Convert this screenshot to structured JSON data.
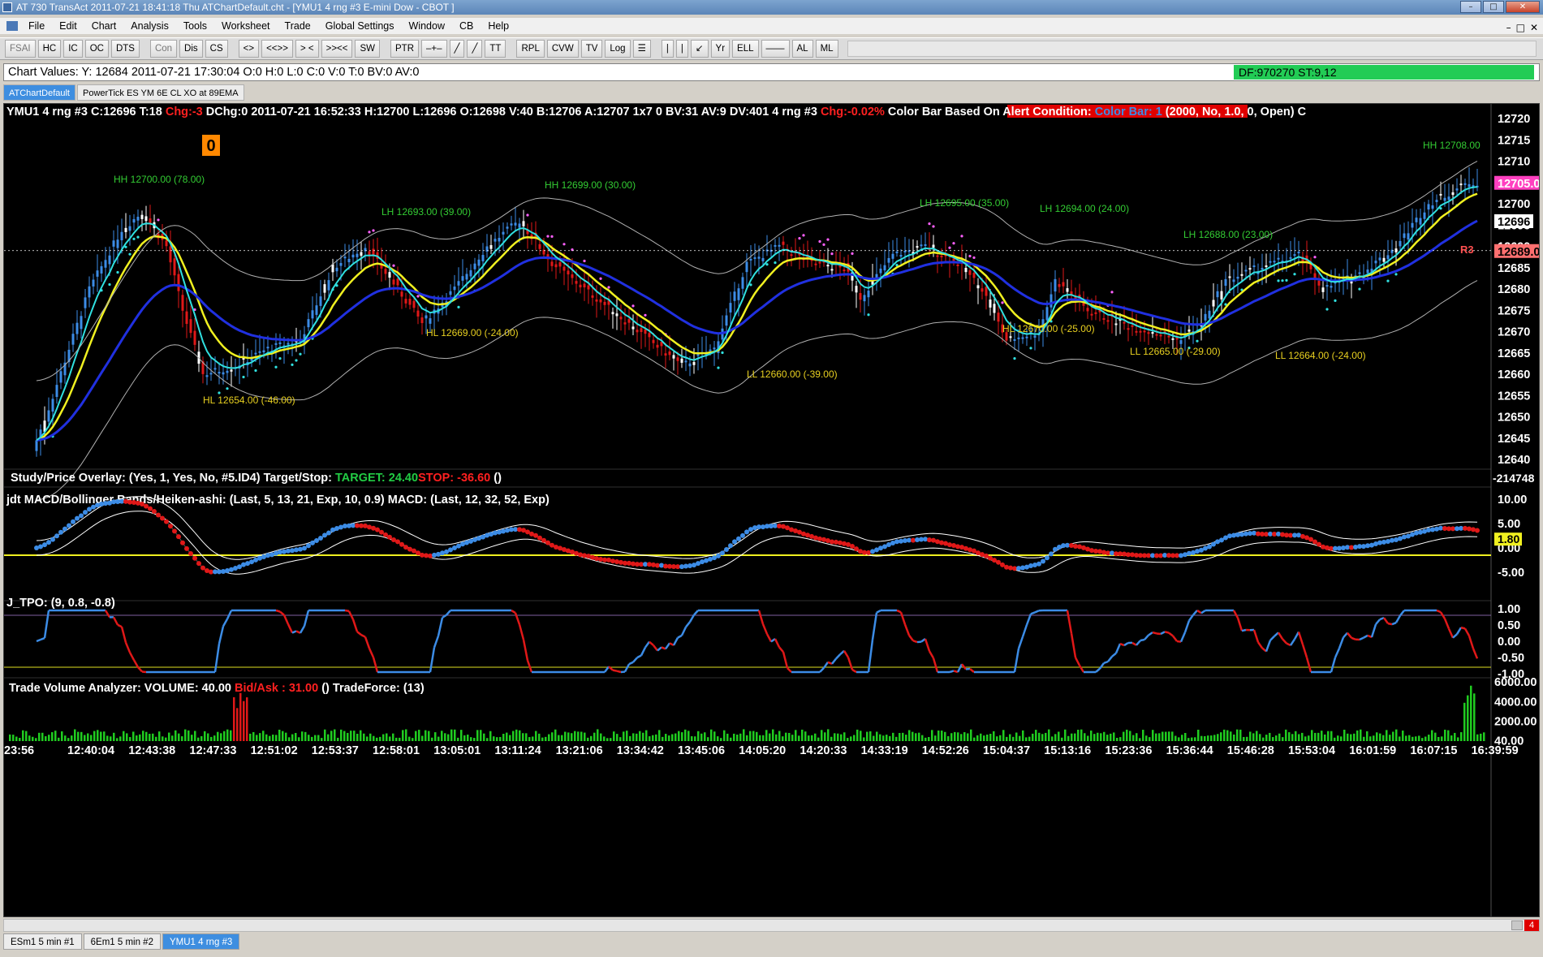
{
  "window": {
    "title": "AT 730 TransAct 2011-07-21  18:41:18  Thu    ATChartDefault.cht - [YMU1  4 rng  #3  E-mini Dow - CBOT    ]",
    "buttons": [
      "–",
      "□",
      "✕"
    ]
  },
  "menu": [
    "File",
    "Edit",
    "Chart",
    "Analysis",
    "Tools",
    "Worksheet",
    "Trade",
    "Global Settings",
    "Window",
    "CB",
    "Help"
  ],
  "mdi_buttons": [
    "–",
    "□",
    "✕"
  ],
  "toolbar": [
    {
      "label": "FSAI",
      "dim": true
    },
    {
      "label": "HC"
    },
    {
      "label": "IC"
    },
    {
      "label": "OC"
    },
    {
      "label": "DTS"
    },
    {
      "label": "Con",
      "dim": true
    },
    {
      "label": "Dis"
    },
    {
      "label": "CS"
    },
    {
      "label": "<>"
    },
    {
      "label": "<<>>"
    },
    {
      "label": "> <"
    },
    {
      "label": ">><<"
    },
    {
      "label": "SW"
    },
    {
      "label": "PTR"
    },
    {
      "label": "–+–"
    },
    {
      "label": "╱"
    },
    {
      "label": "╱"
    },
    {
      "label": "TT"
    },
    {
      "label": "RPL"
    },
    {
      "label": "CVW"
    },
    {
      "label": "TV"
    },
    {
      "label": "Log"
    },
    {
      "label": "☰"
    },
    {
      "label": "|"
    },
    {
      "label": "|"
    },
    {
      "label": "↙"
    },
    {
      "label": "Yr"
    },
    {
      "label": "ELL"
    },
    {
      "label": "——"
    },
    {
      "label": "AL"
    },
    {
      "label": "ML"
    }
  ],
  "values_bar": {
    "text": "Chart Values: Y: 12684  2011-07-21  17:30:04  O:0  H:0  L:0  C:0  V:0  T:0  BV:0  AV:0",
    "df": "DF:970270  ST:9,12"
  },
  "chart_tabs": [
    "ATChartDefault",
    "PowerTick ES YM 6E CL XO at 89EMA"
  ],
  "header": {
    "part1": "YMU1  4 rng  #3 C:12696 T:18 ",
    "chg": "Chg:-3",
    "part2": " DChg:0 2011-07-21 16:52:33 H:12700 L:12696 O:12698 V:40 B:12706 A:12707 1x7 0 BV:31 AV:9 DV:401 4 rng #3 ",
    "chgpct": "Chg:-0.02%",
    "alert": " Color Bar Based On Alert Condition: ",
    "colorbar": "Color Bar: 1",
    "params": "  (2000, No, 1.0, 0, Open)   C"
  },
  "marker": "0",
  "price_axis": [
    "12720",
    "12715",
    "12710",
    "12705",
    "12700",
    "12695",
    "12690",
    "12685",
    "12680",
    "12675",
    "12670",
    "12665",
    "12660",
    "12655",
    "12650",
    "12645",
    "12640"
  ],
  "price_tags": {
    "pink": "12705.0",
    "white": "12696",
    "salmon": "12689.0",
    "r3": "R3"
  },
  "annotations": [
    {
      "text": "HH 12700.00 (78.00)",
      "color": "#33cc33"
    },
    {
      "text": "HL 12654.00 (-46.00)",
      "color": "#e8d020"
    },
    {
      "text": "LH 12693.00 (39.00)",
      "color": "#33cc33"
    },
    {
      "text": "HL 12669.00 (-24.00)",
      "color": "#e8d020"
    },
    {
      "text": "HH 12699.00 (30.00)",
      "color": "#33cc33"
    },
    {
      "text": "LL 12660.00 (-39.00)",
      "color": "#e8d020"
    },
    {
      "text": "LH 12695.00 (35.00)",
      "color": "#33cc33"
    },
    {
      "text": "LH 12694.00 (24.00)",
      "color": "#33cc33"
    },
    {
      "text": "HL 12670.00 (-25.00)",
      "color": "#e8d020"
    },
    {
      "text": "LH 12688.00 (23.00)",
      "color": "#33cc33"
    },
    {
      "text": "LL 12665.00 (-29.00)",
      "color": "#e8d020"
    },
    {
      "text": "LL 12664.00 (-24.00)",
      "color": "#e8d020"
    },
    {
      "text": "HH 12708.00",
      "color": "#33cc33"
    }
  ],
  "overlay_line": {
    "label": "Study/Price Overlay:   (Yes, 1, Yes, No, #5.ID4)   Target/Stop:  ",
    "target": "TARGET: 24.40",
    "stop": "STOP: -36.60",
    "tail": "  ()",
    "axis_value": "-214748"
  },
  "macd_panel": {
    "label": "jdt MACD/Bollinger Bands/Heiken-ashi:   (Last, 5, 13, 21, Exp, 10, 0.9)   MACD:   (Last, 12, 32, 52, Exp)",
    "axis": [
      "10.00",
      "5.00",
      "0.00",
      "-5.00"
    ],
    "value_tag": "1.80"
  },
  "tpo_panel": {
    "label": "J_TPO:   (9, 0.8, -0.8)",
    "axis": [
      "1.00",
      "0.50",
      "0.00",
      "-0.50",
      "-1.00"
    ]
  },
  "volume_panel": {
    "label": "Trade Volume Analyzer:  VOLUME: 40.00  ",
    "bidask": "Bid/Ask : 31.00",
    "tail": "  ()   TradeForce:   (13)",
    "axis": [
      "6000.00",
      "4000.00",
      "2000.00",
      "40.00"
    ]
  },
  "time_axis": [
    "23:56",
    "12:40:04",
    "12:43:38",
    "12:47:33",
    "12:51:02",
    "12:53:37",
    "12:58:01",
    "13:05:01",
    "13:11:24",
    "13:21:06",
    "13:34:42",
    "13:45:06",
    "14:05:20",
    "14:20:33",
    "14:33:19",
    "14:52:26",
    "15:04:37",
    "15:13:16",
    "15:23:36",
    "15:36:44",
    "15:46:28",
    "15:53:04",
    "16:01:59",
    "16:07:15",
    "16:39:59"
  ],
  "bottom_tabs": [
    "ESm1  5 min   #1",
    "6Em1  5 min   #2",
    "YMU1  4 rng  #3"
  ],
  "scroll_badge": "4",
  "colors": {
    "up_bar": "#3c8ce6",
    "down_bar": "#e01818",
    "neutral_bar": "#ffffff",
    "fast_ma": "#30e0e0",
    "slow_ma": "#2030e0",
    "yellow_line": "#f0f020",
    "band": "#b0b0b0",
    "volume": "#20cc20",
    "volume_hi": "#e01818"
  }
}
